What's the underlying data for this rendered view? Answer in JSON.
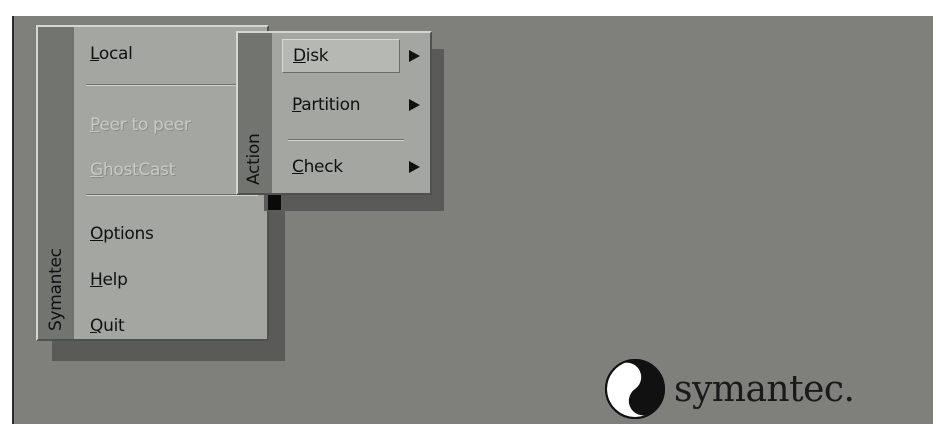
{
  "main_menu": {
    "side_label": "Symantec",
    "items": [
      {
        "first": "L",
        "rest": "ocal",
        "enabled": true
      },
      {
        "first": "P",
        "rest": "eer to peer",
        "enabled": false
      },
      {
        "first": "G",
        "rest": "hostCast",
        "enabled": false
      },
      {
        "first": "O",
        "rest": "ptions",
        "enabled": true
      },
      {
        "first": "H",
        "rest": "elp",
        "enabled": true
      },
      {
        "first": "Q",
        "rest": "uit",
        "enabled": true
      }
    ]
  },
  "action_menu": {
    "side_label": "Action",
    "items": [
      {
        "first": "D",
        "rest": "isk",
        "has_submenu": true,
        "selected": true
      },
      {
        "first": "P",
        "rest": "artition",
        "has_submenu": true,
        "selected": false
      },
      {
        "first": "C",
        "rest": "heck",
        "has_submenu": true,
        "selected": false
      }
    ]
  },
  "brand": {
    "text": "symantec.",
    "icon": "symantec-yin-yang-logo"
  },
  "colors": {
    "desktop": "#7f7f7c",
    "menu": "#a4a6a2",
    "strip": "#727470",
    "disabled_text": "#c8cac6"
  }
}
